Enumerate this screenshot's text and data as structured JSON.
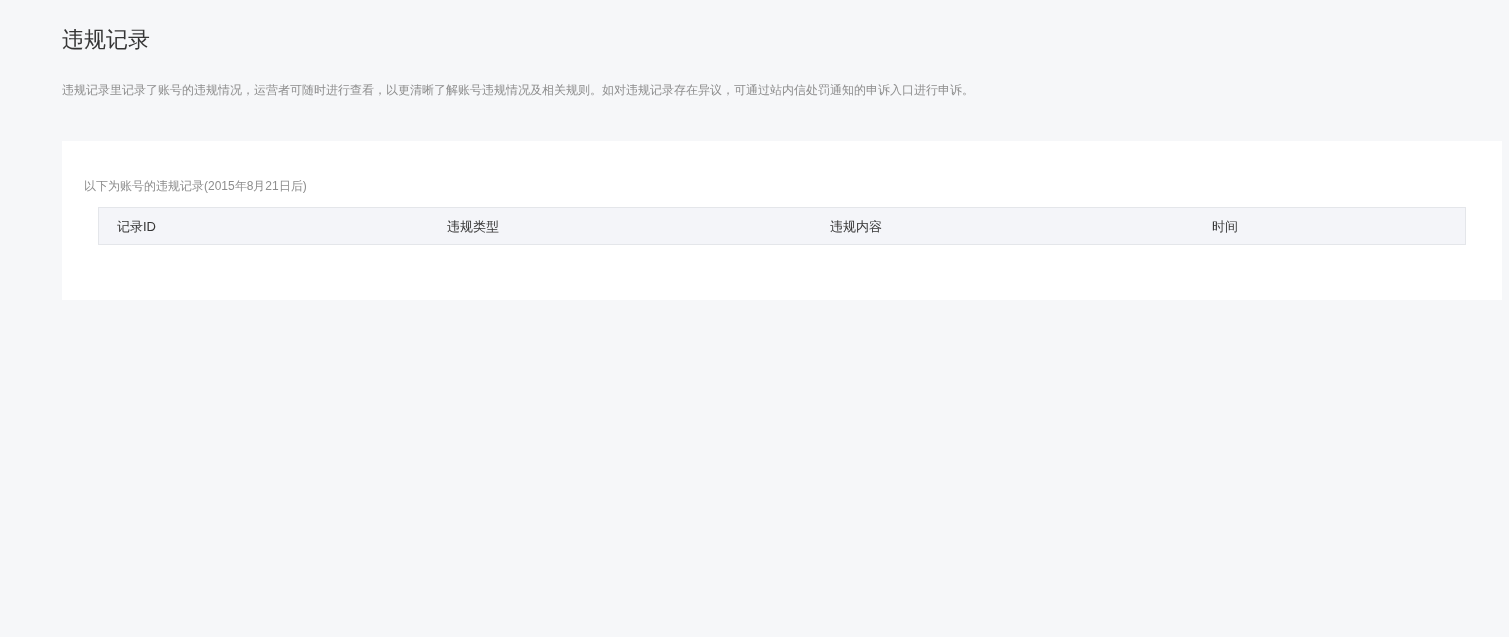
{
  "page": {
    "title": "违规记录",
    "description": "违规记录里记录了账号的违规情况，运营者可随时进行查看，以更清晰了解账号违规情况及相关规则。如对违规记录存在异议，可通过站内信处罚通知的申诉入口进行申诉。"
  },
  "records": {
    "caption": "以下为账号的违规记录(2015年8月21日后)",
    "columns": [
      "记录ID",
      "违规类型",
      "违规内容",
      "时间"
    ]
  }
}
